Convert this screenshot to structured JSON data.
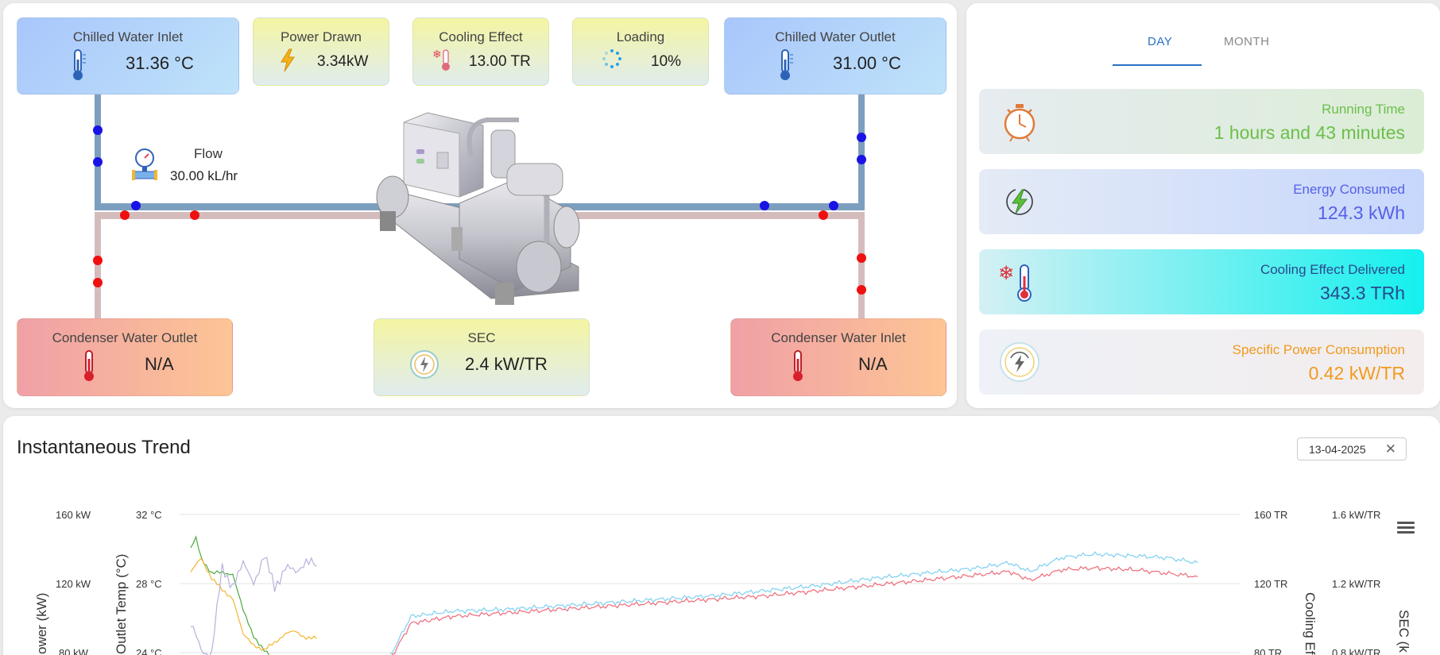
{
  "diagram": {
    "chilled_inlet": {
      "title": "Chilled Water Inlet",
      "value": "31.36 °C"
    },
    "power_drawn": {
      "title": "Power Drawn",
      "value": "3.34kW"
    },
    "cooling_effect": {
      "title": "Cooling Effect",
      "value": "13.00 TR"
    },
    "loading": {
      "title": "Loading",
      "value": "10%"
    },
    "chilled_outlet": {
      "title": "Chilled Water Outlet",
      "value": "31.00 °C"
    },
    "flow": {
      "label": "Flow",
      "value": "30.00 kL/hr"
    },
    "condenser_outlet": {
      "title": "Condenser Water Outlet",
      "value": "N/A"
    },
    "sec": {
      "title": "SEC",
      "value": "2.4 kW/TR"
    },
    "condenser_inlet": {
      "title": "Condenser Water Inlet",
      "value": "N/A"
    }
  },
  "summary": {
    "tabs": [
      {
        "label": "DAY",
        "active": true
      },
      {
        "label": "MONTH",
        "active": false
      }
    ],
    "cards": [
      {
        "title": "Running Time",
        "value": "1 hours and 43 minutes",
        "color": "#6bbf4a",
        "icon": "stopwatch-icon"
      },
      {
        "title": "Energy Consumed",
        "value": "124.3 kWh",
        "color": "#5560e8",
        "icon": "energy-bolt-icon"
      },
      {
        "title": "Cooling Effect Delivered",
        "value": "343.3 TRh",
        "color": "#2a4a8c",
        "icon": "snowflake-thermometer-icon"
      },
      {
        "title": "Specific Power Consumption",
        "value": "0.42 kW/TR",
        "color": "#f09a1e",
        "icon": "spc-gauge-icon"
      }
    ]
  },
  "trend": {
    "title": "Instantaneous Trend",
    "date": "13-04-2025",
    "axes": {
      "power": {
        "title": "ower (kW)",
        "ticks": [
          "160 kW",
          "120 kW",
          "80 kW"
        ]
      },
      "temp": {
        "title": "Outlet Temp (°C)",
        "ticks": [
          "32 °C",
          "28 °C",
          "24 °C"
        ]
      },
      "cooling": {
        "title": "Cooling Ef",
        "ticks": [
          "160 TR",
          "120 TR",
          "80 TR"
        ]
      },
      "sec": {
        "title": "SEC (k",
        "ticks": [
          "1.6 kW/TR",
          "1.2 kW/TR",
          "0.8 kW/TR"
        ]
      }
    },
    "colors": {
      "cyan": "#7ed0f0",
      "red": "#ee6a7a",
      "green": "#4bab3c",
      "orange": "#f2b631",
      "lavender": "#b8b0dc"
    }
  },
  "chart_data": {
    "type": "line",
    "ylim_power": [
      80,
      160
    ],
    "ylim_temp": [
      24,
      32
    ],
    "ylim_cooling": [
      80,
      160
    ],
    "ylim_sec": [
      0.8,
      1.6
    ],
    "series": [
      {
        "axis": "cooling",
        "color": "#7ed0f0",
        "x": [
          0.19,
          0.21,
          0.25,
          0.3,
          0.35,
          0.4,
          0.45,
          0.5,
          0.55,
          0.6,
          0.65,
          0.7,
          0.75,
          0.78,
          0.8,
          0.83,
          0.86,
          0.9,
          0.93,
          0.96
        ],
        "values": [
          78,
          101,
          104,
          105,
          107,
          109,
          111,
          113,
          116,
          119,
          123,
          126,
          129,
          132,
          127,
          135,
          137,
          136,
          135,
          132
        ]
      },
      {
        "axis": "cooling",
        "color": "#ee6a7a",
        "x": [
          0.19,
          0.21,
          0.25,
          0.3,
          0.35,
          0.4,
          0.45,
          0.5,
          0.55,
          0.6,
          0.65,
          0.7,
          0.75,
          0.78,
          0.8,
          0.83,
          0.86,
          0.9,
          0.93,
          0.96
        ],
        "values": [
          76,
          97,
          101,
          103,
          105,
          107,
          109,
          111,
          113,
          116,
          119,
          122,
          125,
          127,
          122,
          128,
          129,
          128,
          126,
          124
        ]
      },
      {
        "axis": "temp",
        "color": "#4bab3c",
        "x": [
          0.0,
          0.005,
          0.01,
          0.02,
          0.03,
          0.04,
          0.05,
          0.06,
          0.07,
          0.08,
          0.09,
          0.1,
          0.11,
          0.12
        ],
        "values": [
          30.0,
          30.6,
          29.5,
          28.6,
          28.6,
          28.6,
          26.4,
          25.0,
          24.1,
          23.5,
          23.0,
          23.2,
          23.0,
          23.0
        ]
      },
      {
        "axis": "temp",
        "color": "#f2b631",
        "x": [
          0.0,
          0.01,
          0.02,
          0.03,
          0.04,
          0.05,
          0.06,
          0.07,
          0.08,
          0.09,
          0.1,
          0.11,
          0.12
        ],
        "values": [
          28.6,
          29.5,
          28.3,
          27.6,
          27.2,
          25.0,
          24.5,
          24.1,
          24.6,
          25.1,
          25.2,
          24.9,
          24.8
        ]
      },
      {
        "axis": "sec",
        "color": "#b8b0dc",
        "x": [
          0.0,
          0.01,
          0.02,
          0.03,
          0.04,
          0.05,
          0.06,
          0.07,
          0.08,
          0.09,
          0.1,
          0.11,
          0.12
        ],
        "values": [
          0.95,
          0.82,
          0.8,
          1.28,
          1.2,
          1.3,
          1.22,
          1.35,
          1.18,
          1.3,
          1.25,
          1.35,
          1.3
        ]
      }
    ]
  }
}
